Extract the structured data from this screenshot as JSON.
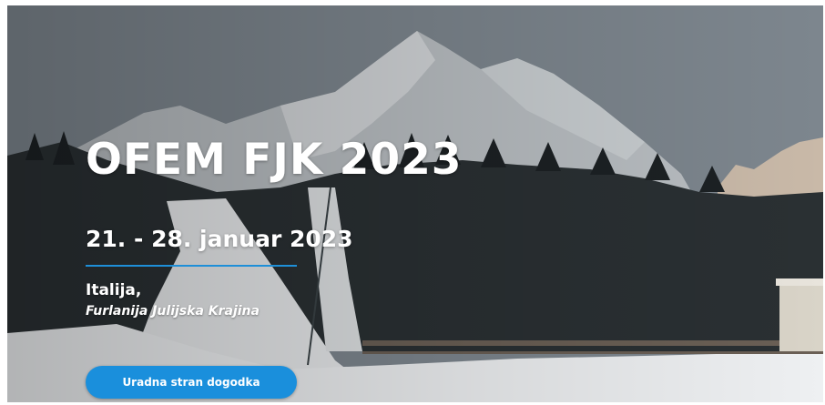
{
  "hero": {
    "title": "OFEM FJK 2023",
    "dates": "21. - 28. januar 2023",
    "country": "Italija,",
    "region": "Furlanija Julijska Krajina",
    "cta_label": "Uradna stran dogodka"
  },
  "colors": {
    "accent": "#1a8fdc",
    "divider": "#1e8fd8",
    "text": "#ffffff"
  }
}
